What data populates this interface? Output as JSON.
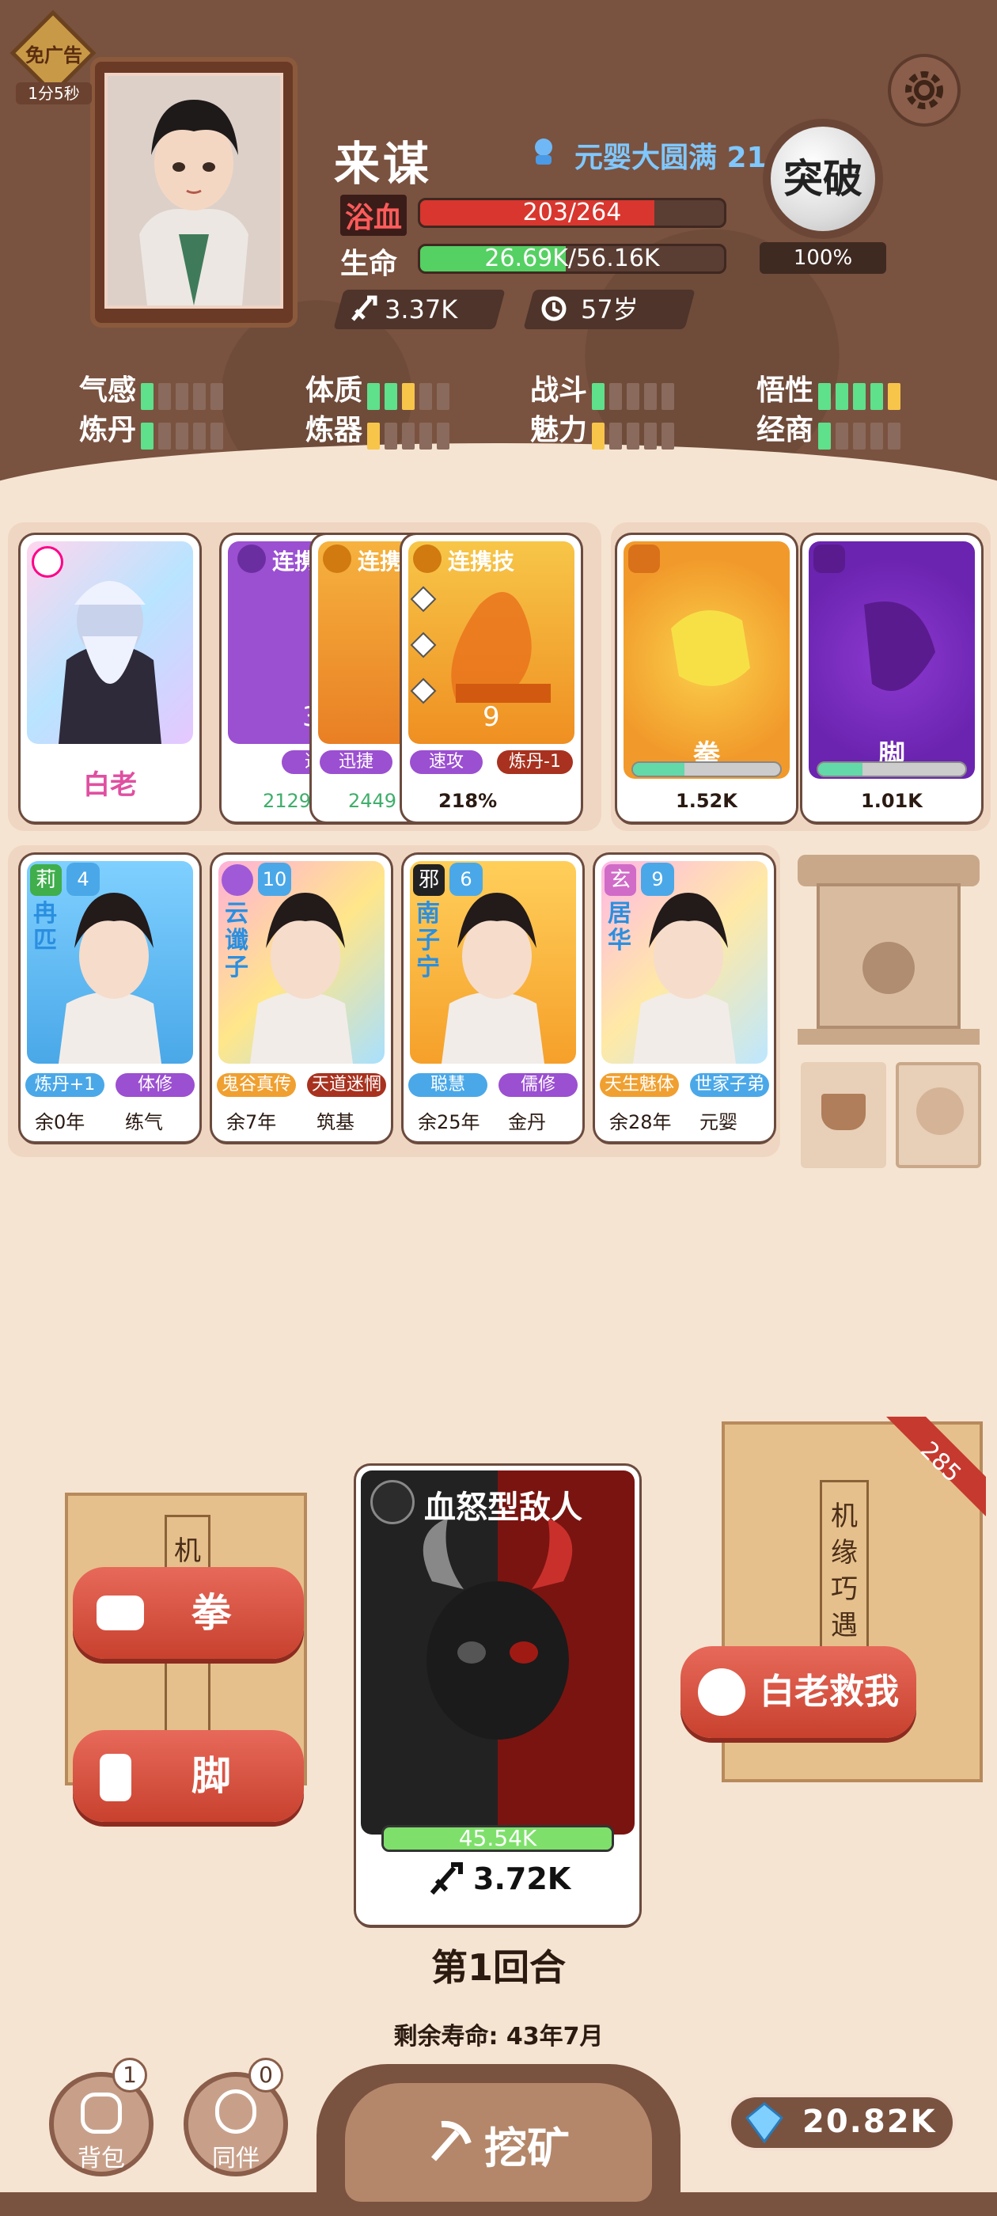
{
  "profile": {
    "ad_badge": "免广告",
    "ad_timer": "1分5秒",
    "name": "来谋",
    "realm": "元婴大圆满 21",
    "breakthrough_label": "突破",
    "breakthrough_percent": "100%",
    "bath_label": "浴血",
    "bath_value": "203/264",
    "bath_fill": 0.77,
    "life_label": "生命",
    "life_value": "26.69K/56.16K",
    "life_fill": 0.48,
    "power": "3.37K",
    "age": "57岁"
  },
  "attributes": [
    {
      "label": "气感",
      "segs": [
        "g",
        "n",
        "n",
        "n",
        "n"
      ]
    },
    {
      "label": "体质",
      "segs": [
        "g",
        "g",
        "y",
        "n",
        "n"
      ]
    },
    {
      "label": "战斗",
      "segs": [
        "g",
        "n",
        "n",
        "n",
        "n"
      ]
    },
    {
      "label": "悟性",
      "segs": [
        "g",
        "g",
        "g",
        "g",
        "y"
      ]
    },
    {
      "label": "炼丹",
      "segs": [
        "g",
        "n",
        "n",
        "n",
        "n"
      ]
    },
    {
      "label": "炼器",
      "segs": [
        "y",
        "n",
        "n",
        "n",
        "n"
      ]
    },
    {
      "label": "魅力",
      "segs": [
        "y",
        "n",
        "n",
        "n",
        "n"
      ]
    },
    {
      "label": "经商",
      "segs": [
        "g",
        "n",
        "n",
        "n",
        "n"
      ]
    }
  ],
  "row1": {
    "elder": {
      "name": "白老"
    },
    "combo": {
      "title": "连携技",
      "title_partial_a": "连携",
      "title_partial_b": "连携",
      "count": "9",
      "partial_count": "3",
      "tags": [
        "迅",
        "迅捷",
        "速攻",
        "炼丹-1"
      ],
      "powers": [
        "2129",
        "2449",
        "218%"
      ]
    },
    "fist": {
      "name": "拳",
      "power": "1.52K",
      "fill": 0.35
    },
    "kick": {
      "name": "脚",
      "power": "1.01K",
      "fill": 0.3
    }
  },
  "companions": [
    {
      "tag": "莉",
      "level": "4",
      "name": "冉匹",
      "traits": [
        "炼丹+1",
        "体修"
      ],
      "remaining": "余0年",
      "realm": "练气"
    },
    {
      "tag": "",
      "level": "10",
      "name": "云谶子",
      "traits": [
        "鬼谷真传",
        "天道迷惘"
      ],
      "remaining": "余7年",
      "realm": "筑基"
    },
    {
      "tag": "邪",
      "level": "6",
      "name": "南子宁",
      "traits": [
        "聪慧",
        "儒修"
      ],
      "remaining": "余25年",
      "realm": "金丹"
    },
    {
      "tag": "玄",
      "level": "9",
      "name": "居华",
      "traits": [
        "天生魅体",
        "世家子弟"
      ],
      "remaining": "余28年",
      "realm": "元婴"
    }
  ],
  "battle": {
    "enemy_title": "血怒型敌人",
    "enemy_hp": "45.54K",
    "enemy_power": "3.72K",
    "round": "第1回合",
    "lifespan": "剩余寿命: 43年7月",
    "left_scroll_text": "机缘",
    "right_scroll_text": "机缘巧遇",
    "gem_cost": "285",
    "fist_button": "拳",
    "kick_button": "脚",
    "rescue_button": "白老救我"
  },
  "bottom": {
    "bag_label": "背包",
    "bag_count": "1",
    "partner_label": "同伴",
    "partner_count": "0",
    "mine_label": "挖矿",
    "gems": "20.82K"
  }
}
